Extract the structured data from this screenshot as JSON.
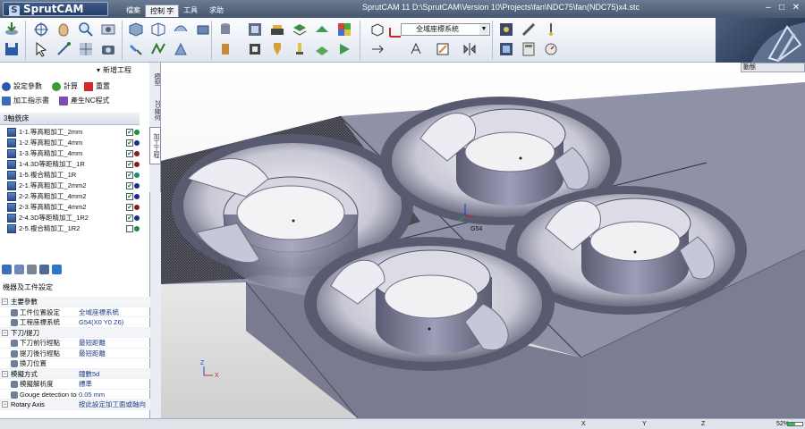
{
  "app": {
    "logo": "SprutCAM",
    "menu_tabs": [
      "檔案",
      "控制 字",
      "工具",
      "求助"
    ],
    "title": "SprutCAM 11   D:\\SprutCAM\\Version 10\\Projects\\fan\\NDC75\\fan(NDC75)x4.stc"
  },
  "ribbon": {
    "coord_system": "全域座標系統"
  },
  "left_panel": {
    "new_operation": "新增工程",
    "actions": {
      "settings": "設定參數",
      "calculate": "計算",
      "reset": "重置",
      "setup_sheet": "加工指示書",
      "post_nc": "產生NC程式"
    },
    "ops_header": "3軸銑床",
    "operations": [
      {
        "label": "1-1.等高粗加工_2mm",
        "checked": true,
        "color": "#1e8c3a"
      },
      {
        "label": "1-2.等高粗加工_4mm",
        "checked": true,
        "color": "#1b2a8a"
      },
      {
        "label": "1-3.等高精加工_4mm",
        "checked": true,
        "color": "#8a1a1a"
      },
      {
        "label": "1-4.3D等距精加工_1R",
        "checked": true,
        "color": "#8a1a1a"
      },
      {
        "label": "1-5.複合精加工_1R",
        "checked": true,
        "color": "#1e8c6a"
      },
      {
        "label": "2-1.等高粗加工_2mm2",
        "checked": true,
        "color": "#1b2a8a"
      },
      {
        "label": "2-2.等高粗加工_4mm2",
        "checked": true,
        "color": "#1b2a8a"
      },
      {
        "label": "2-3.等高精加工_4mm2",
        "checked": true,
        "color": "#8a1a1a"
      },
      {
        "label": "2-4.3D等距精加工_1R2",
        "checked": true,
        "color": "#1b2a8a"
      },
      {
        "label": "2-5.複合精加工_1R2",
        "checked": false,
        "color": "#1e8c3a"
      }
    ],
    "vertical_tabs": [
      "模型",
      "2D幾何",
      "加工工程"
    ],
    "properties_title": "機器及工件設定",
    "properties": [
      {
        "type": "section",
        "label": "主要參數",
        "value": ""
      },
      {
        "type": "item",
        "label": "工件位置設定",
        "value": "全域座標系統"
      },
      {
        "type": "item",
        "label": "工程座標系統",
        "value": "G54(X0 Y0 Z6)"
      },
      {
        "type": "section",
        "label": "下刀/提刀",
        "value": ""
      },
      {
        "type": "item",
        "label": "下刀前行經點",
        "value": "最短距離"
      },
      {
        "type": "item",
        "label": "提刀後行經點",
        "value": "最短距離"
      },
      {
        "type": "item",
        "label": "換刀位置",
        "value": ""
      },
      {
        "type": "section",
        "label": "模擬方式",
        "value": "鐘數5d"
      },
      {
        "type": "item",
        "label": "模擬解析度",
        "value": "標準"
      },
      {
        "type": "item",
        "label": "Gouge detection tol",
        "value": "0.05 mm"
      },
      {
        "type": "section",
        "label": "Rotary Axis",
        "value": "按此設定加工面或軸向"
      }
    ]
  },
  "viewport": {
    "filter_label": "動態",
    "origin_label": "G54",
    "axes": {
      "x": "X",
      "y": "Y",
      "z": "Z"
    }
  },
  "statusbar": {
    "coords": [
      "X",
      "Y",
      "Z"
    ],
    "zoom_text": "52%",
    "zoom_fraction": 0.52
  }
}
